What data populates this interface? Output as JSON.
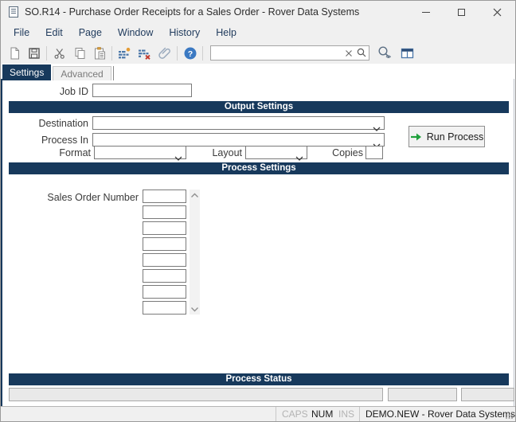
{
  "colors": {
    "header_navy": "#17395c",
    "run_arrow_green": "#1fa03c",
    "toolbar_icon_blue": "#4a76a8",
    "help_blue": "#3b79c2",
    "delete_red": "#c23a2e",
    "insert_orange": "#e39b35",
    "chrome_gray": "#f0f0f0"
  },
  "window": {
    "title": "SO.R14 - Purchase Order Receipts for a Sales Order - Rover Data Systems",
    "controls": [
      "minimize",
      "maximize",
      "close"
    ]
  },
  "menu": {
    "items": [
      {
        "label": "File"
      },
      {
        "label": "Edit"
      },
      {
        "label": "Page"
      },
      {
        "label": "Window"
      },
      {
        "label": "History"
      },
      {
        "label": "Help"
      }
    ]
  },
  "toolbar": {
    "icons": [
      "new-document",
      "save",
      "cut",
      "copy",
      "paste",
      "insert-row",
      "delete-row",
      "attachment",
      "help",
      "search-clear",
      "search-magnifier",
      "lookup-preview",
      "browse-table"
    ],
    "search": {
      "value": "",
      "placeholder": ""
    }
  },
  "tabs": {
    "items": [
      {
        "label": "Settings",
        "active": true
      },
      {
        "label": "Advanced",
        "active": false
      }
    ]
  },
  "form": {
    "job_id": {
      "label": "Job ID",
      "value": ""
    },
    "output_settings": {
      "title": "Output Settings",
      "destination": {
        "label": "Destination",
        "value": ""
      },
      "process_in": {
        "label": "Process In",
        "value": ""
      },
      "format": {
        "label": "Format",
        "value": ""
      },
      "layout": {
        "label": "Layout",
        "value": ""
      },
      "copies": {
        "label": "Copies",
        "value": ""
      },
      "run_button": {
        "label": "Run Process"
      }
    },
    "process_settings": {
      "title": "Process Settings",
      "sales_order_number": {
        "label": "Sales Order Number",
        "values": [
          "",
          "",
          "",
          "",
          "",
          "",
          "",
          ""
        ]
      }
    },
    "process_status": {
      "title": "Process Status",
      "fields": [
        "",
        "",
        ""
      ]
    }
  },
  "statusbar": {
    "caps": "CAPS",
    "num": "NUM",
    "ins": "INS",
    "caps_enabled": false,
    "num_enabled": true,
    "ins_enabled": false,
    "context": "DEMO.NEW - Rover Data Systems"
  }
}
